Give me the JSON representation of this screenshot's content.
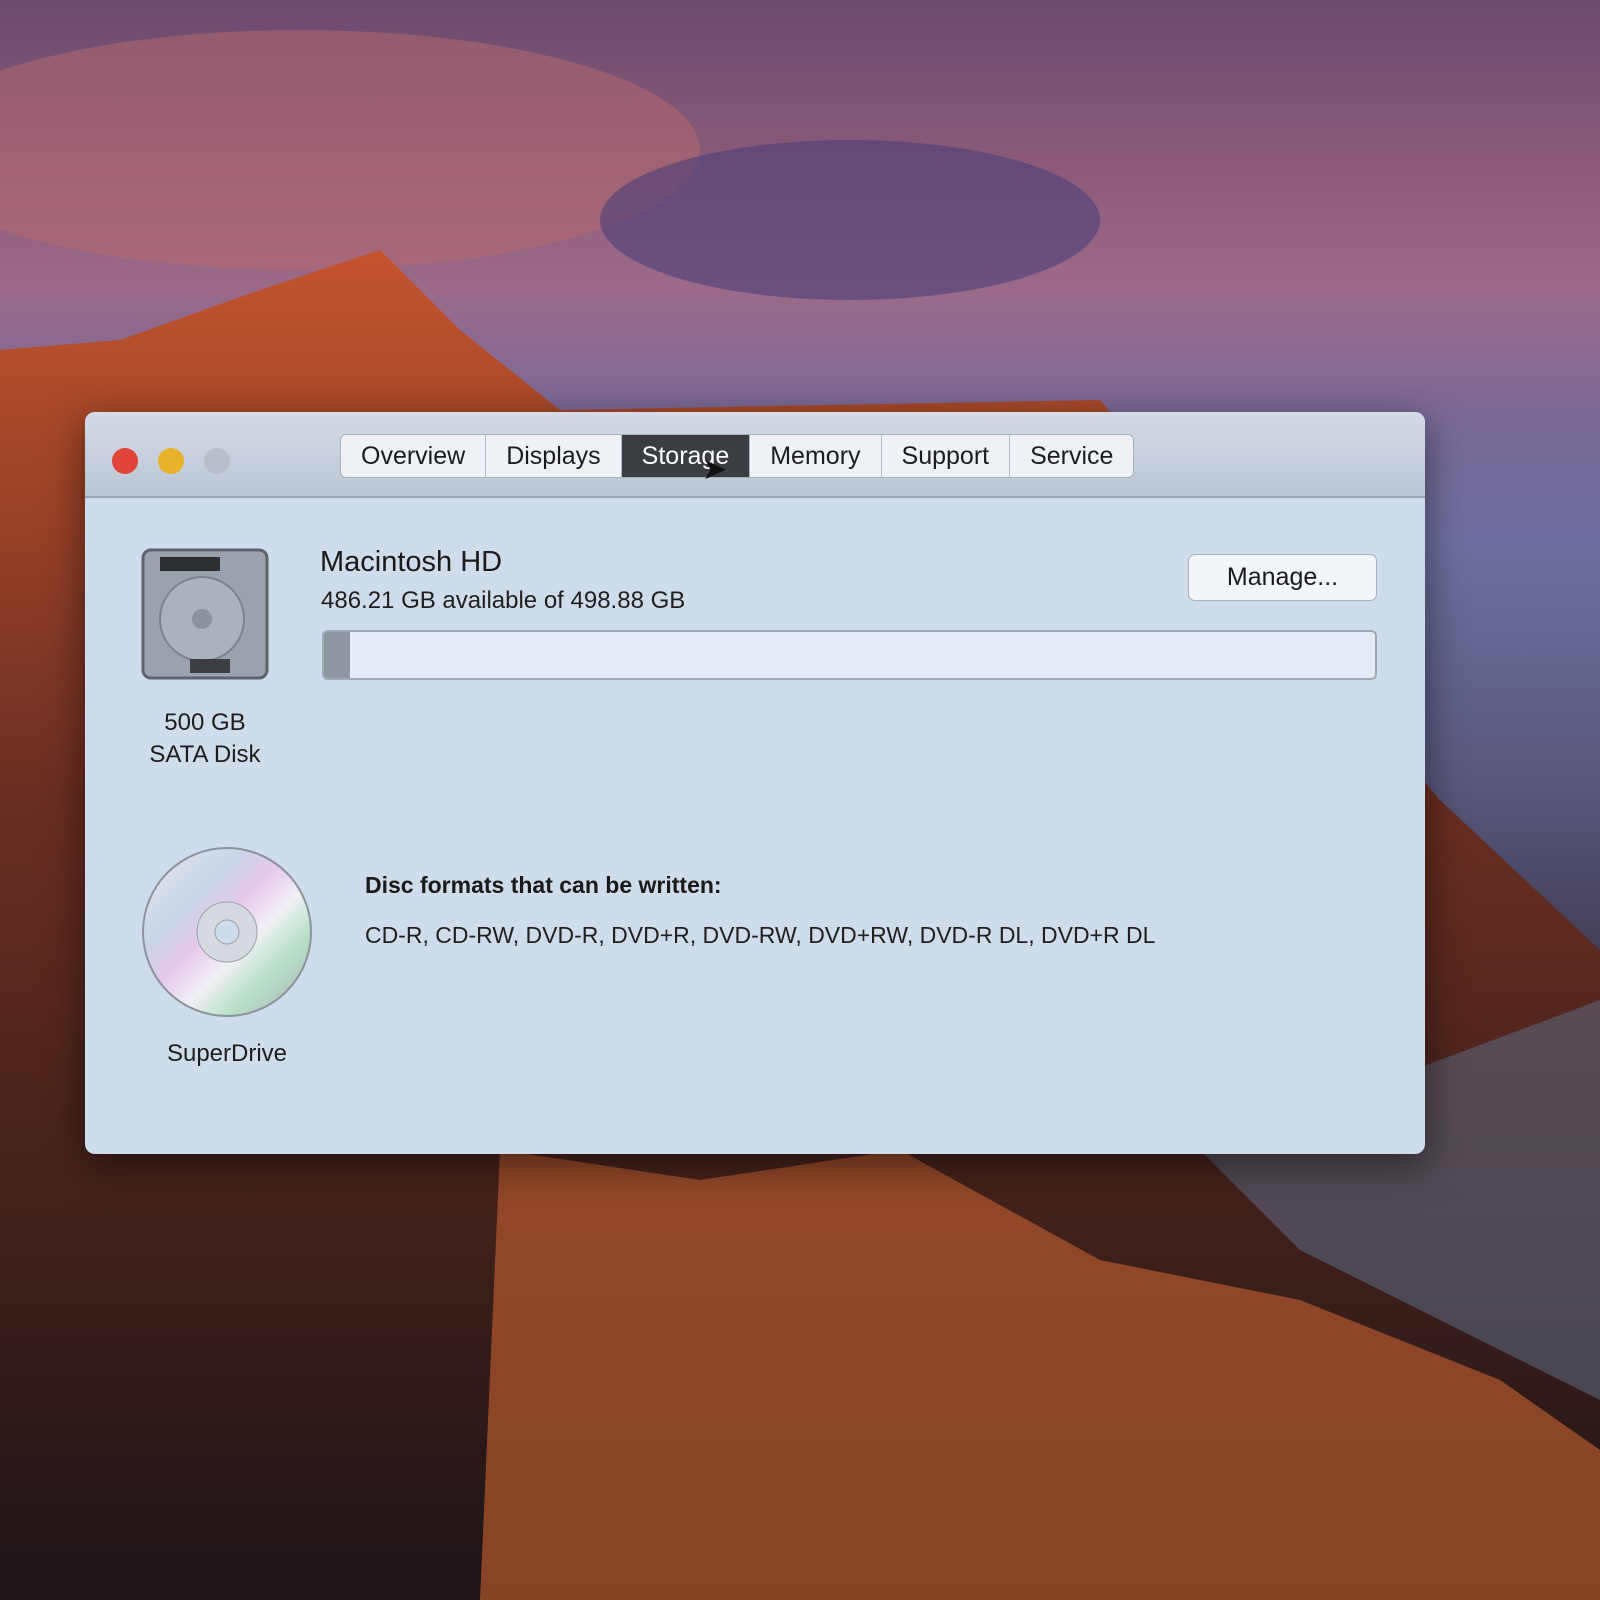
{
  "window": {
    "tabs": [
      "Overview",
      "Displays",
      "Storage",
      "Memory",
      "Support",
      "Service"
    ],
    "selected_tab": "Storage"
  },
  "storage": {
    "disk": {
      "size": "500 GB",
      "type": "SATA Disk",
      "volume_name": "Macintosh HD",
      "availability": "486.21 GB available of 498.88 GB",
      "used_fraction": 0.025,
      "manage_label": "Manage..."
    },
    "optical": {
      "name": "SuperDrive",
      "heading": "Disc formats that can be written:",
      "formats": "CD-R, CD-RW, DVD-R, DVD+R, DVD-RW, DVD+RW, DVD-R DL, DVD+R DL"
    }
  },
  "colors": {
    "close": "#e0443a",
    "minimize": "#e9b22b",
    "disabled": "#b9bfc8",
    "selected_tab": "#3a3d42"
  }
}
